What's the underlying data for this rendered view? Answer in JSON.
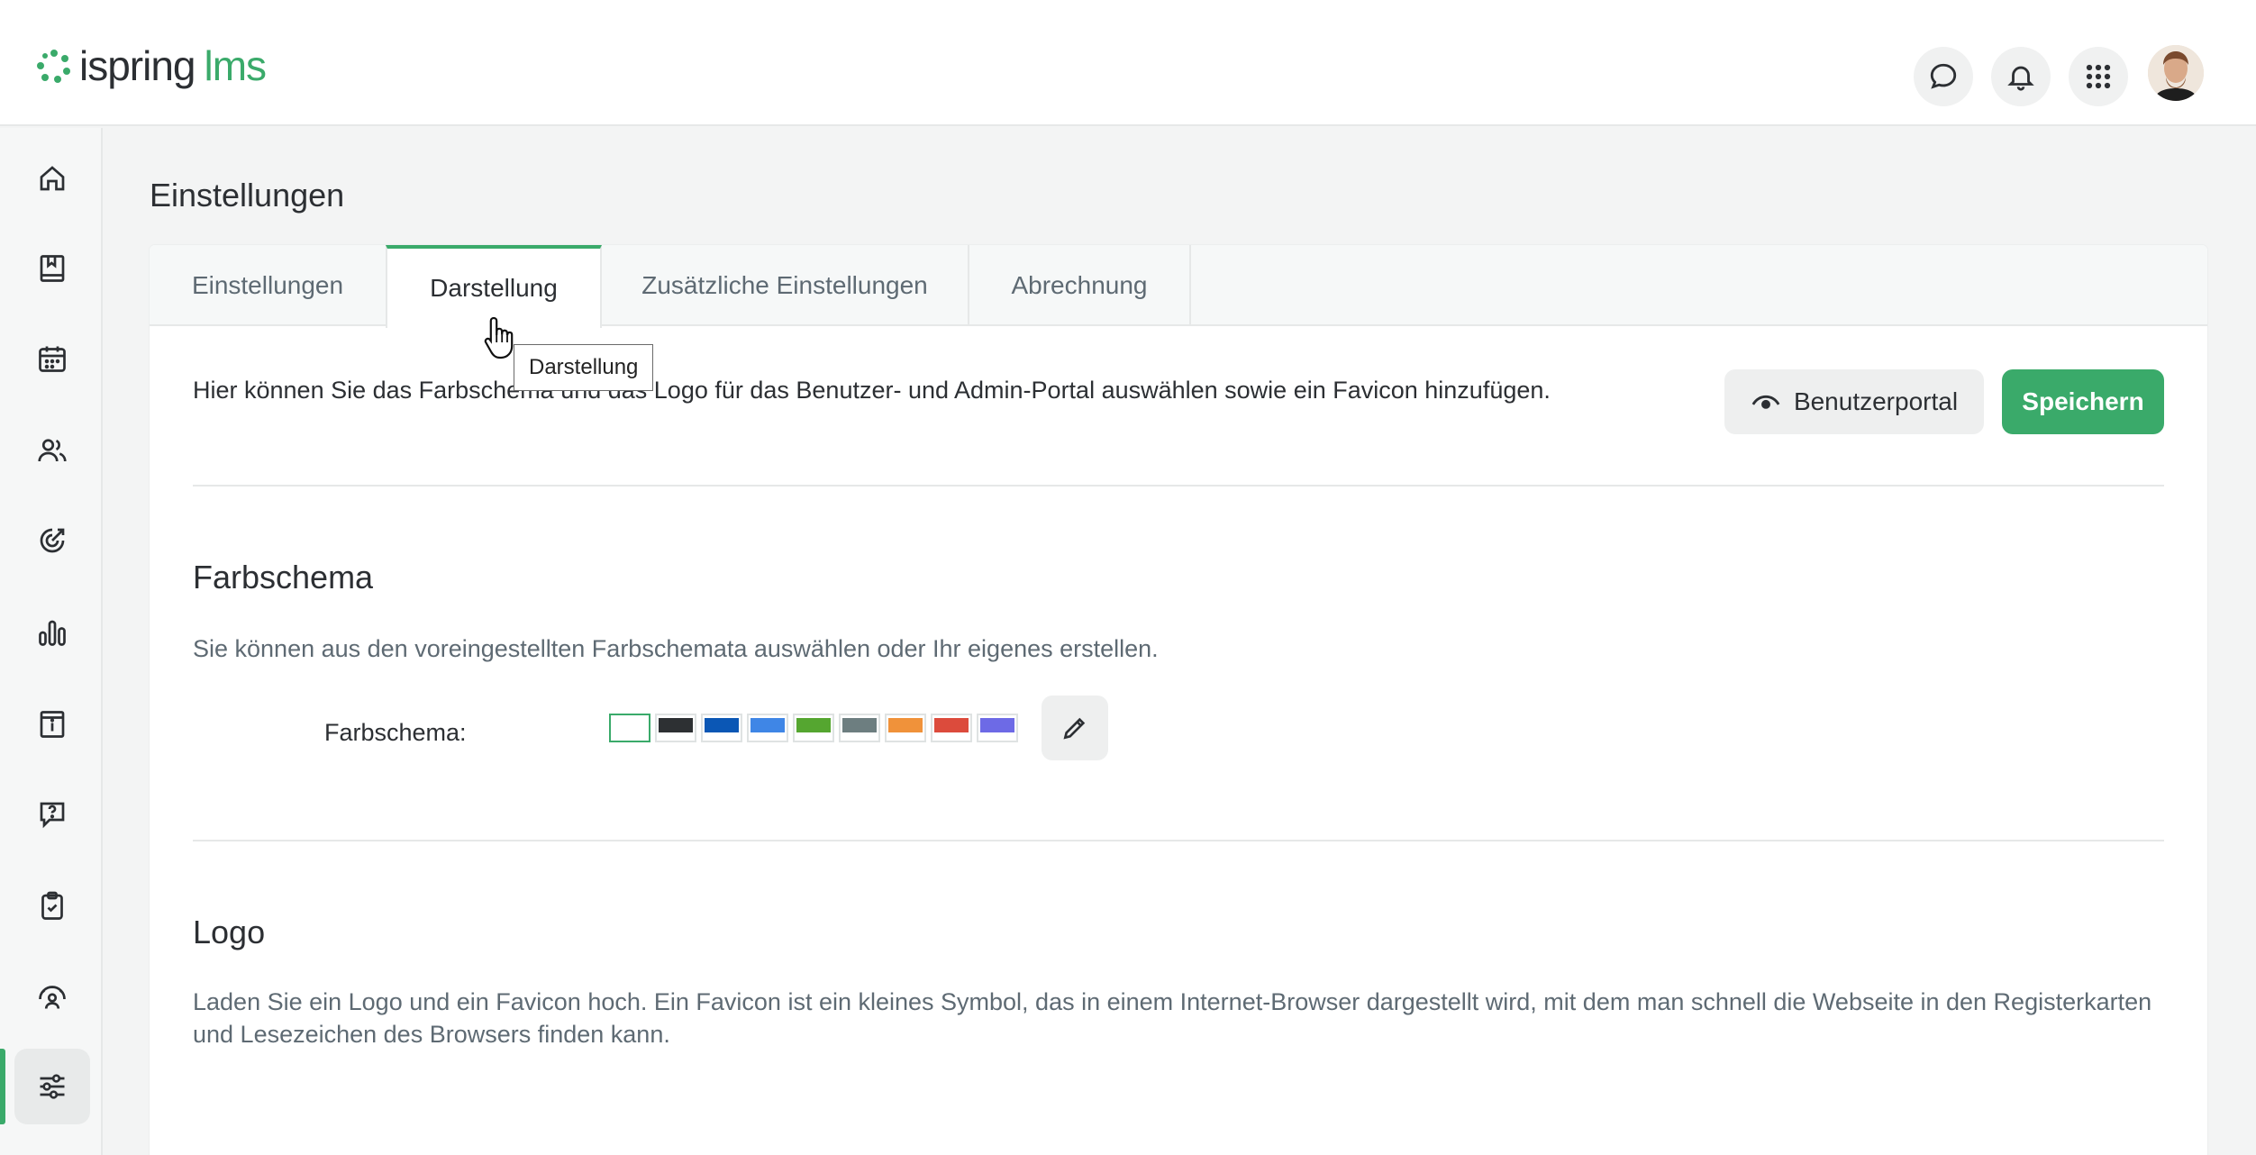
{
  "app": {
    "logo_word1": "ispring",
    "logo_word2": "lms",
    "brand_color": "#3aaa6a"
  },
  "header": {
    "icons": [
      "chat-icon",
      "bell-icon",
      "apps-grid-icon"
    ],
    "avatar_icon": "user-avatar"
  },
  "sidebar": {
    "items": [
      {
        "icon": "home-icon"
      },
      {
        "icon": "book-icon"
      },
      {
        "icon": "calendar-icon"
      },
      {
        "icon": "users-icon"
      },
      {
        "icon": "target-icon"
      },
      {
        "icon": "bar-chart-icon"
      },
      {
        "icon": "info-card-icon"
      },
      {
        "icon": "help-chat-icon"
      },
      {
        "icon": "clipboard-check-icon"
      },
      {
        "icon": "gauge-user-icon"
      },
      {
        "icon": "sliders-icon",
        "active": true
      }
    ]
  },
  "page": {
    "title": "Einstellungen"
  },
  "tabs": [
    {
      "label": "Einstellungen"
    },
    {
      "label": "Darstellung",
      "active": true
    },
    {
      "label": "Zusätzliche Einstellungen"
    },
    {
      "label": "Abrechnung"
    }
  ],
  "tooltip": {
    "text": "Darstellung"
  },
  "intro": {
    "text": "Hier können Sie das Farbschema und das Logo für das Benutzer- und Admin-Portal auswählen sowie ein Favicon hinzufügen.",
    "portal_button": "Benutzerportal",
    "save_button": "Speichern"
  },
  "farbschema": {
    "title": "Farbschema",
    "description": "Sie können aus den voreingestellten Farbschemata auswählen oder Ihr eigenes erstellen.",
    "label": "Farbschema:",
    "swatches": [
      "#ffffff",
      "#2d3033",
      "#0b57b5",
      "#3f86e6",
      "#55a630",
      "#6d7e80",
      "#f0923a",
      "#dc4b3c",
      "#6d6ae6"
    ],
    "selected_index": 0
  },
  "logo": {
    "title": "Logo",
    "description": "Laden Sie ein Logo und ein Favicon hoch. Ein Favicon ist ein kleines Symbol, das in einem Internet-Browser dargestellt wird, mit dem man schnell die Webseite in den Registerkarten und Lesezeichen des Browsers finden kann."
  }
}
